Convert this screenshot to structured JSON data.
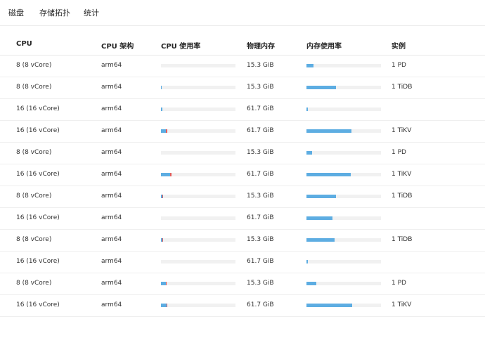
{
  "tabs": [
    {
      "label": "磁盘"
    },
    {
      "label": "存储拓扑"
    },
    {
      "label": "统计"
    }
  ],
  "columns": [
    "CPU",
    "CPU 架构",
    "CPU 使用率",
    "物理内存",
    "内存使用率",
    "实例"
  ],
  "colors": {
    "user": "#5dade2",
    "system": "#e05c5c",
    "memory": "#5dade2",
    "track": "#f1f1f1"
  },
  "rows": [
    {
      "cpu": "8 (8 vCore)",
      "arch": "arm64",
      "cpu_user": 0,
      "cpu_sys": 0,
      "mem": "15.3 GiB",
      "mem_usage": 0.09,
      "instance": "1 PD"
    },
    {
      "cpu": "8 (8 vCore)",
      "arch": "arm64",
      "cpu_user": 0.01,
      "cpu_sys": 0,
      "mem": "15.3 GiB",
      "mem_usage": 0.4,
      "instance": "1 TiDB"
    },
    {
      "cpu": "16 (16 vCore)",
      "arch": "arm64",
      "cpu_user": 0.02,
      "cpu_sys": 0,
      "mem": "61.7 GiB",
      "mem_usage": 0.02,
      "instance": ""
    },
    {
      "cpu": "16 (16 vCore)",
      "arch": "arm64",
      "cpu_user": 0.07,
      "cpu_sys": 0.02,
      "mem": "61.7 GiB",
      "mem_usage": 0.6,
      "instance": "1 TiKV"
    },
    {
      "cpu": "8 (8 vCore)",
      "arch": "arm64",
      "cpu_user": 0,
      "cpu_sys": 0,
      "mem": "15.3 GiB",
      "mem_usage": 0.08,
      "instance": "1 PD"
    },
    {
      "cpu": "16 (16 vCore)",
      "arch": "arm64",
      "cpu_user": 0.12,
      "cpu_sys": 0.02,
      "mem": "61.7 GiB",
      "mem_usage": 0.59,
      "instance": "1 TiKV"
    },
    {
      "cpu": "8 (8 vCore)",
      "arch": "arm64",
      "cpu_user": 0.02,
      "cpu_sys": 0.01,
      "mem": "15.3 GiB",
      "mem_usage": 0.4,
      "instance": "1 TiDB"
    },
    {
      "cpu": "16 (16 vCore)",
      "arch": "arm64",
      "cpu_user": 0,
      "cpu_sys": 0,
      "mem": "61.7 GiB",
      "mem_usage": 0.35,
      "instance": ""
    },
    {
      "cpu": "8 (8 vCore)",
      "arch": "arm64",
      "cpu_user": 0.02,
      "cpu_sys": 0.01,
      "mem": "15.3 GiB",
      "mem_usage": 0.38,
      "instance": "1 TiDB"
    },
    {
      "cpu": "16 (16 vCore)",
      "arch": "arm64",
      "cpu_user": 0,
      "cpu_sys": 0,
      "mem": "61.7 GiB",
      "mem_usage": 0.02,
      "instance": ""
    },
    {
      "cpu": "8 (8 vCore)",
      "arch": "arm64",
      "cpu_user": 0.07,
      "cpu_sys": 0.01,
      "mem": "15.3 GiB",
      "mem_usage": 0.13,
      "instance": "1 PD"
    },
    {
      "cpu": "16 (16 vCore)",
      "arch": "arm64",
      "cpu_user": 0.08,
      "cpu_sys": 0.01,
      "mem": "61.7 GiB",
      "mem_usage": 0.61,
      "instance": "1 TiKV"
    }
  ]
}
